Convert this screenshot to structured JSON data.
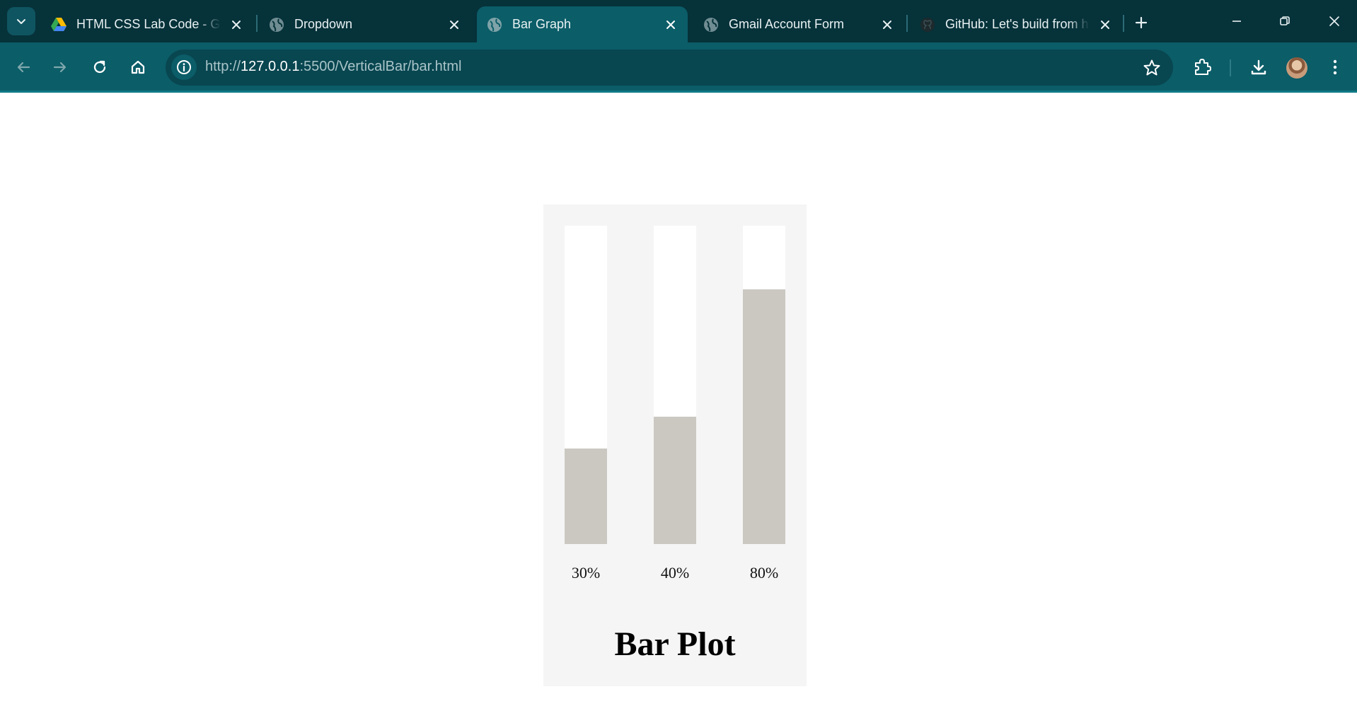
{
  "browser": {
    "tabs": [
      {
        "title": "HTML CSS Lab Code - Go",
        "icon": "google-drive-icon",
        "active": false
      },
      {
        "title": "Dropdown",
        "icon": "globe-icon",
        "active": false
      },
      {
        "title": "Bar Graph",
        "icon": "globe-icon",
        "active": true
      },
      {
        "title": "Gmail Account Form",
        "icon": "globe-icon",
        "active": false
      },
      {
        "title": "GitHub: Let's build from h",
        "icon": "github-icon",
        "active": false
      }
    ],
    "url": {
      "scheme": "http://",
      "host": "127.0.0.1",
      "rest": ":5500/VerticalBar/bar.html"
    },
    "colors": {
      "tabstrip": "#06323a",
      "toolbar": "#0b5d68",
      "omnibox": "#084650"
    }
  },
  "page": {
    "bars": [
      {
        "label": "30%",
        "value": 30
      },
      {
        "label": "40%",
        "value": 40
      },
      {
        "label": "80%",
        "value": 80
      }
    ],
    "title": "Bar Plot",
    "colors": {
      "card": "#f5f5f5",
      "track": "#ffffff",
      "fill": "#cbc8c2"
    }
  }
}
